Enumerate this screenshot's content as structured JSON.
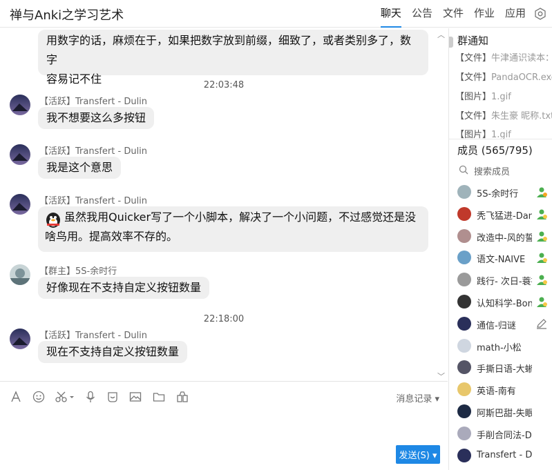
{
  "header": {
    "title": "禅与Anki之学习艺术",
    "tabs": [
      {
        "label": "聊天",
        "active": true
      },
      {
        "label": "公告",
        "active": false
      },
      {
        "label": "文件",
        "active": false
      },
      {
        "label": "作业",
        "active": false
      },
      {
        "label": "应用",
        "active": false
      }
    ],
    "settings_icon": "gear-icon"
  },
  "messages": [
    {
      "text_line1": "用数字的话，麻烦在于，如果把数字放到前缀，细致了，或者类别多了，数字",
      "text_line2": "容易记不住"
    },
    {
      "time": "22:03:48"
    },
    {
      "sender": "【活跃】Transfert - Dulin",
      "text": "我不想要这么多按钮"
    },
    {
      "sender": "【活跃】Transfert - Dulin",
      "text": "我是这个意思"
    },
    {
      "sender": "【活跃】Transfert - Dulin",
      "text_line1": "虽然我用Quicker写了一个小脚本，解决了一个小问题，不过感觉还是没",
      "text_line2": "啥鸟用。提高效率不存的。"
    },
    {
      "sender": "【群主】5S-余时行",
      "text": "好像现在不支持自定义按钮数量"
    },
    {
      "time": "22:18:00"
    },
    {
      "sender": "【活跃】Transfert - Dulin",
      "text": "现在不支持自定义按钮数量"
    }
  ],
  "toolbar": {
    "history_label": "消息记录 ▾",
    "send_label": "发送(S) ▾"
  },
  "notice": {
    "title": "群通知",
    "files": [
      {
        "tag": "【文件】",
        "name": "牛津通识读本："
      },
      {
        "tag": "【文件】",
        "name": "PandaOCR.exe"
      },
      {
        "tag": "【图片】",
        "name": "1.gif"
      },
      {
        "tag": "【文件】",
        "name": "朱生豪 昵称.txt"
      },
      {
        "tag": "【图片】",
        "name": "1.gif"
      }
    ]
  },
  "members": {
    "title": "成员 (565/795)",
    "search_placeholder": "搜索成员",
    "list": [
      {
        "name": "5S-余时行",
        "badge": "owner"
      },
      {
        "name": "秃飞猛进-Dan",
        "badge": "admin"
      },
      {
        "name": "改造中-风的誓",
        "badge": "admin"
      },
      {
        "name": "语文-NAIVE",
        "badge": "admin"
      },
      {
        "name": "践行- 次日-蓑衣",
        "badge": "admin"
      },
      {
        "name": "认知科学-Bon",
        "badge": "admin"
      },
      {
        "name": "通信-归谜",
        "badge": "edit"
      },
      {
        "name": "math-小松",
        "badge": ""
      },
      {
        "name": "手撕日语-大蜥蜴",
        "badge": ""
      },
      {
        "name": "英语-南有",
        "badge": ""
      },
      {
        "name": "阿斯巴甜-失眠",
        "badge": ""
      },
      {
        "name": "手削合同法-Dasein",
        "badge": ""
      },
      {
        "name": "Transfert - Dulin",
        "badge": ""
      }
    ]
  },
  "colors": {
    "accent": "#1e88e5",
    "bubble": "#efefef"
  }
}
